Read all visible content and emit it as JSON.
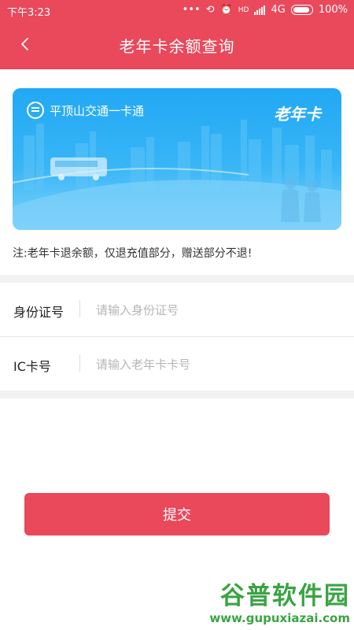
{
  "status_bar": {
    "time": "下午3:23",
    "icons": [
      "more-dots-icon",
      "sync-icon",
      "alarm-icon",
      "hd-signal-icon",
      "signal-icon"
    ],
    "network": "4G",
    "battery": "100%"
  },
  "header": {
    "back_icon": "chevron-left-icon",
    "title": "老年卡余额查询"
  },
  "card": {
    "brand": "平顶山交通一卡通",
    "card_type": "老年卡",
    "colors": {
      "top": "#22a8f4",
      "bottom": "#7dd3fb"
    }
  },
  "note": "注:老年卡退余额，仅退充值部分，赠送部分不退!",
  "form": {
    "id_label": "身份证号",
    "id_placeholder": "请输入身份证号",
    "ic_label": "IC卡号",
    "ic_placeholder": "请输入老年卡卡号"
  },
  "submit_label": "提交",
  "watermark": {
    "title": "谷普软件园",
    "url": "www.gupuxiazai.com"
  },
  "colors": {
    "accent": "#e9495b",
    "divider": "#f2f2f2",
    "watermark": "#3aa443"
  }
}
